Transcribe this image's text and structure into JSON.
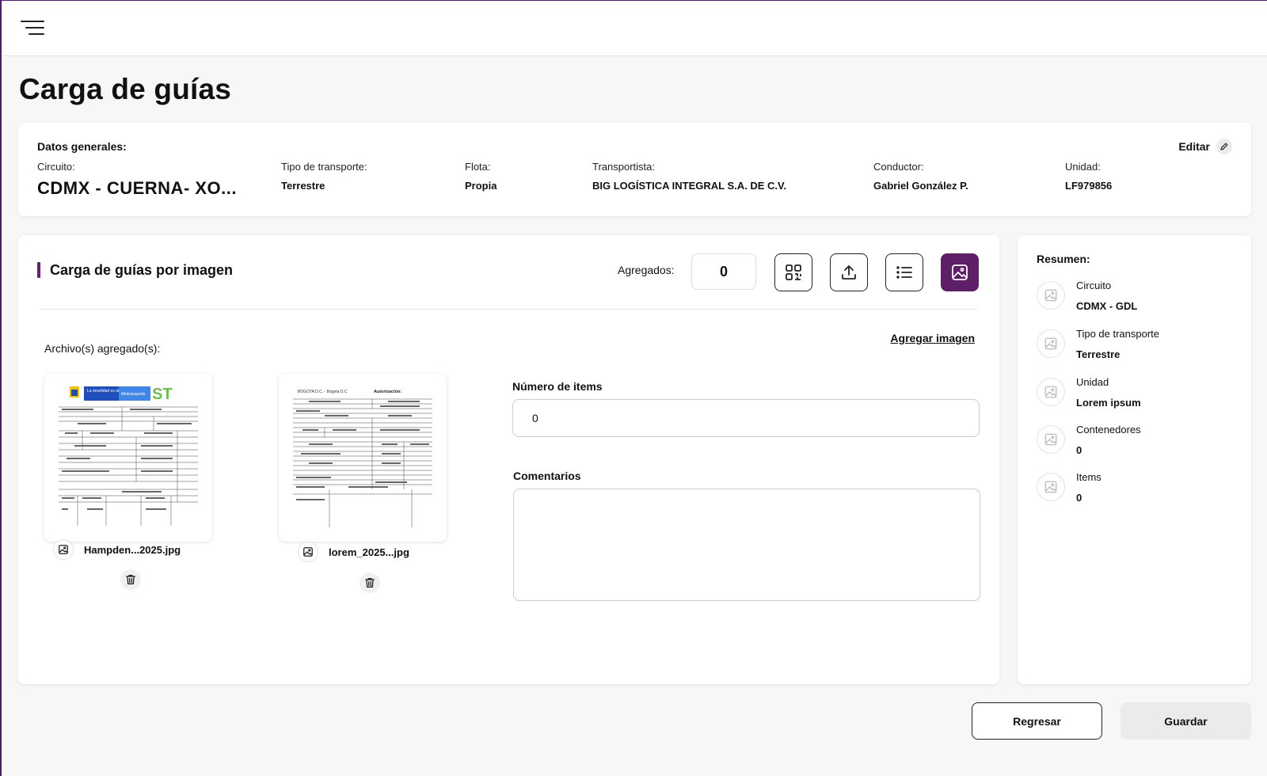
{
  "page": {
    "title": "Carga de guías"
  },
  "general": {
    "heading": "Datos generales:",
    "edit_label": "Editar",
    "fields": [
      {
        "label": "Circuito:",
        "value": "CDMX - CUERNA- XO..."
      },
      {
        "label": "Tipo de transporte:",
        "value": "Terrestre"
      },
      {
        "label": "Flota:",
        "value": "Propia"
      },
      {
        "label": "Transportista:",
        "value": "BIG LOGÍSTICA INTEGRAL S.A. DE C.V."
      },
      {
        "label": "Conductor:",
        "value": "Gabriel González P."
      },
      {
        "label": "Unidad:",
        "value": "LF979856"
      }
    ]
  },
  "upload": {
    "title": "Carga de guías por imagen",
    "added_label": "Agregados:",
    "added_count": "0",
    "files_label": "Archivo(s) agregado(s):",
    "add_image_link": "Agregar imagen",
    "files": [
      {
        "name": "Hampden...2025.jpg",
        "preview": {
          "brand": "La movilidad es de todos",
          "ministry": "Mintransporte",
          "logo": "ST"
        }
      },
      {
        "name": "lorem_2025...jpg",
        "preview": {
          "header_left": "BOGOTA D.C. - Bogota D.C",
          "header_right": "Autorización:"
        }
      }
    ],
    "items_label": "Número de items",
    "items_value": "0",
    "comments_label": "Comentarios",
    "comments_value": ""
  },
  "summary": {
    "heading": "Resumen:",
    "items": [
      {
        "label": "Circuito",
        "value": "CDMX - GDL"
      },
      {
        "label": "Tipo de transporte",
        "value": "Terrestre"
      },
      {
        "label": "Unidad",
        "value": "Lorem ipsum"
      },
      {
        "label": "Contenedores",
        "value": "0"
      },
      {
        "label": "Items",
        "value": "0"
      }
    ]
  },
  "actions": {
    "back_label": "Regresar",
    "save_label": "Guardar"
  },
  "colors": {
    "accent": "#5e1f66",
    "frame": "#4b2163"
  }
}
